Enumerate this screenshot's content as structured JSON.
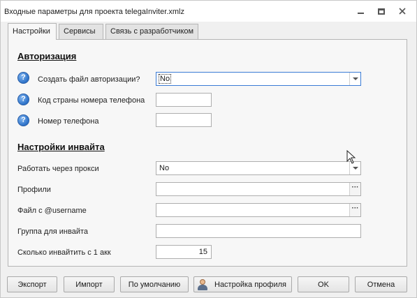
{
  "window": {
    "title": "Входные параметры для проекта telegaInviter.xmlz"
  },
  "tabs": [
    {
      "label": "Настройки",
      "active": true
    },
    {
      "label": "Сервисы",
      "active": false
    },
    {
      "label": "Связь с разработчиком",
      "active": false
    }
  ],
  "auth": {
    "title": "Авторизация",
    "create_file_label": "Создать файл авторизации?",
    "create_file_value": "No",
    "country_code_label": "Код страны номера телефона",
    "country_code_value": "",
    "phone_label": "Номер телефона",
    "phone_value": ""
  },
  "invite": {
    "title": "Настройки инвайта",
    "proxy_label": "Работать через прокси",
    "proxy_value": "No",
    "profiles_label": "Профили",
    "profiles_value": "",
    "username_file_label": "Файл с @username",
    "username_file_value": "",
    "group_label": "Группа для инвайта",
    "group_value": "",
    "count_label": "Сколько инвайтить с 1 акк",
    "count_value": "15"
  },
  "help_icon_glyph": "?",
  "ellipsis_glyph": "···",
  "buttons": {
    "export": "Экспорт",
    "import": "Импорт",
    "default": "По умолчанию",
    "profile": "Настройка профиля",
    "ok": "OK",
    "cancel": "Отмена"
  },
  "icons": {
    "help": "question-circle-icon",
    "user": "user-icon",
    "minimize": "minimize-icon",
    "maximize": "maximize-icon",
    "close": "close-icon"
  }
}
